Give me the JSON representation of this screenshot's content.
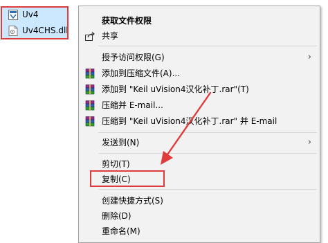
{
  "files": [
    {
      "name": "Uv4",
      "icon": "uvision-app-icon"
    },
    {
      "name": "Uv4CHS.dll",
      "icon": "dll-file-icon"
    }
  ],
  "menu": {
    "items": [
      {
        "label": "获取文件权限",
        "bold": true,
        "icon": "none"
      },
      {
        "label": "共享",
        "icon": "share-icon"
      },
      {
        "label": "授予访问权限(G)",
        "submenu": true,
        "icon": "none"
      },
      {
        "label": "添加到压缩文件(A)...",
        "icon": "winrar-icon"
      },
      {
        "label": "添加到 \"Keil uVision4汉化补丁.rar\"(T)",
        "icon": "winrar-icon"
      },
      {
        "label": "压缩并 E-mail...",
        "icon": "winrar-icon"
      },
      {
        "label": "压缩到 \"Keil uVision4汉化补丁.rar\" 并 E-mail",
        "icon": "winrar-icon"
      },
      {
        "label": "发送到(N)",
        "submenu": true,
        "icon": "none"
      },
      {
        "label": "剪切(T)",
        "icon": "none"
      },
      {
        "label": "复制(C)",
        "icon": "none",
        "highlighted": true
      },
      {
        "label": "创建快捷方式(S)",
        "icon": "none"
      },
      {
        "label": "删除(D)",
        "icon": "none"
      },
      {
        "label": "重命名(M)",
        "icon": "none"
      }
    ],
    "submenu_glyph": "›"
  },
  "colors": {
    "selection": "#cce8ff",
    "menu_background": "#f2f2f2",
    "annotation": "#e03b3b"
  }
}
